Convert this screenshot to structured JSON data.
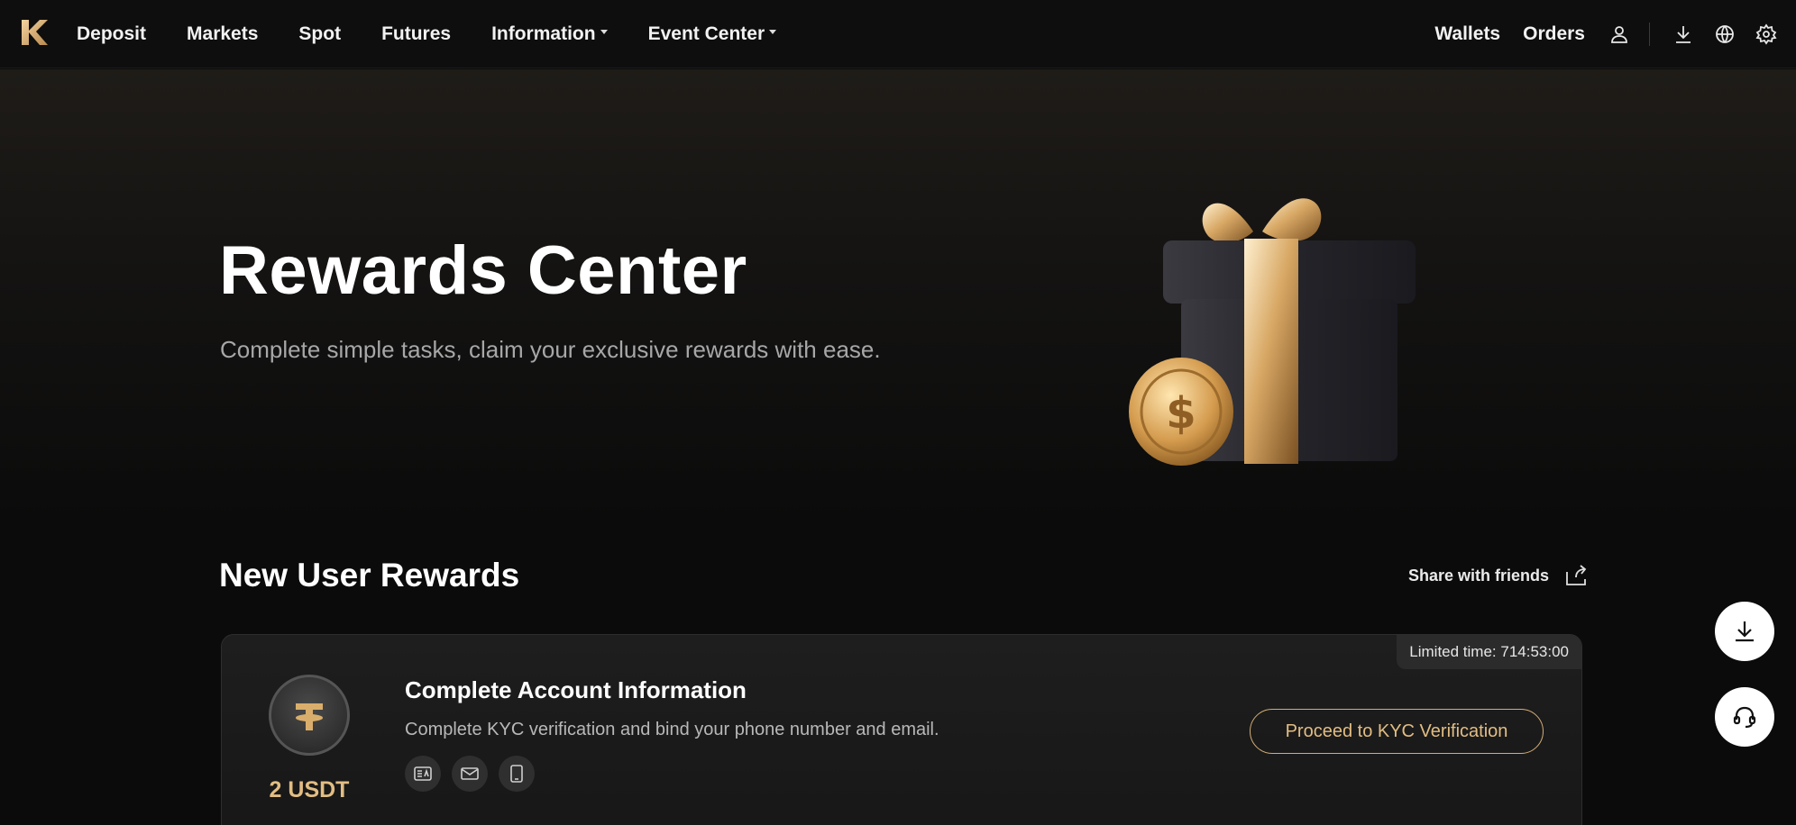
{
  "nav": {
    "left": [
      {
        "label": "Deposit"
      },
      {
        "label": "Markets"
      },
      {
        "label": "Spot"
      },
      {
        "label": "Futures"
      },
      {
        "label": "Information",
        "has_dropdown": true
      },
      {
        "label": "Event Center",
        "has_dropdown": true
      }
    ],
    "wallets": "Wallets",
    "orders": "Orders",
    "icons": [
      "user-icon",
      "download-icon",
      "globe-icon",
      "gear-icon"
    ]
  },
  "hero": {
    "title": "Rewards Center",
    "subtitle": "Complete simple tasks, claim your exclusive rewards with ease."
  },
  "section": {
    "title": "New User Rewards",
    "share_label": "Share with friends"
  },
  "task": {
    "badge": "Limited time: 714:53:00",
    "reward": "2 USDT",
    "title": "Complete Account Information",
    "description": "Complete KYC verification and bind your phone number and email.",
    "icons": [
      "id-card-icon",
      "mail-icon",
      "phone-icon"
    ],
    "button": "Proceed to KYC Verification"
  },
  "colors": {
    "accent_gold": "#e2bd83",
    "background": "#0b0b0b"
  }
}
